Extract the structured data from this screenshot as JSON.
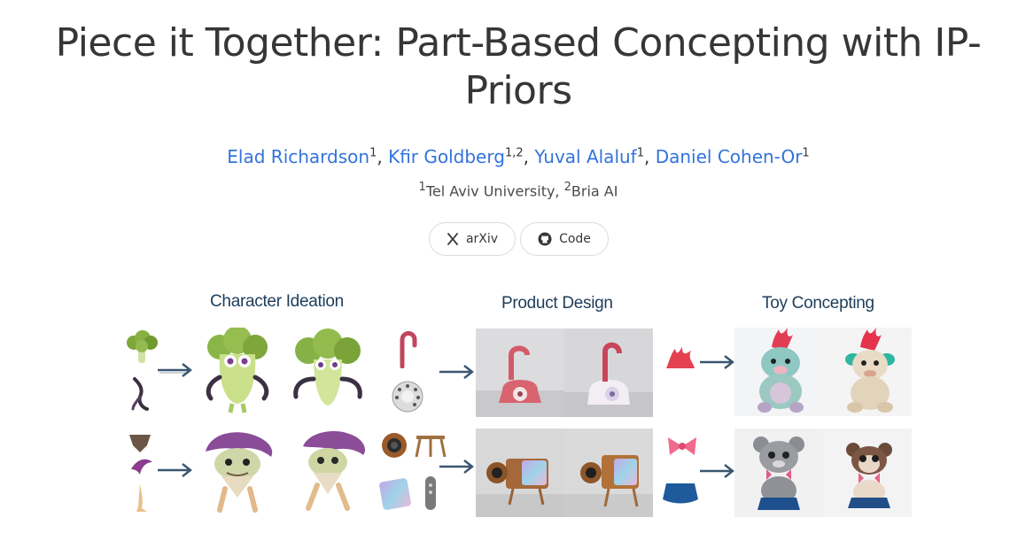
{
  "title": "Piece it Together: Part-Based Concepting with IP-Priors",
  "authors": [
    {
      "name": "Elad Richardson",
      "sup": "1"
    },
    {
      "name": "Kfir Goldberg",
      "sup": "1,2"
    },
    {
      "name": "Yuval Alaluf",
      "sup": "1"
    },
    {
      "name": "Daniel Cohen-Or",
      "sup": "1"
    }
  ],
  "separator": ", ",
  "affiliations": {
    "sup1": "1",
    "name1": "Tel Aviv University, ",
    "sup2": "2",
    "name2": "Bria AI"
  },
  "buttons": {
    "arxiv": {
      "label": "arXiv",
      "icon": "arxiv-x-icon"
    },
    "code": {
      "label": "Code",
      "icon": "github-icon"
    }
  },
  "teaser": {
    "character_ideation": "Character Ideation",
    "product_design": "Product Design",
    "toy_concepting": "Toy Concepting"
  },
  "colors": {
    "link": "#3273dc",
    "text": "#363636",
    "column_title": "#1d3d5a",
    "arrow": "#3a5670"
  }
}
